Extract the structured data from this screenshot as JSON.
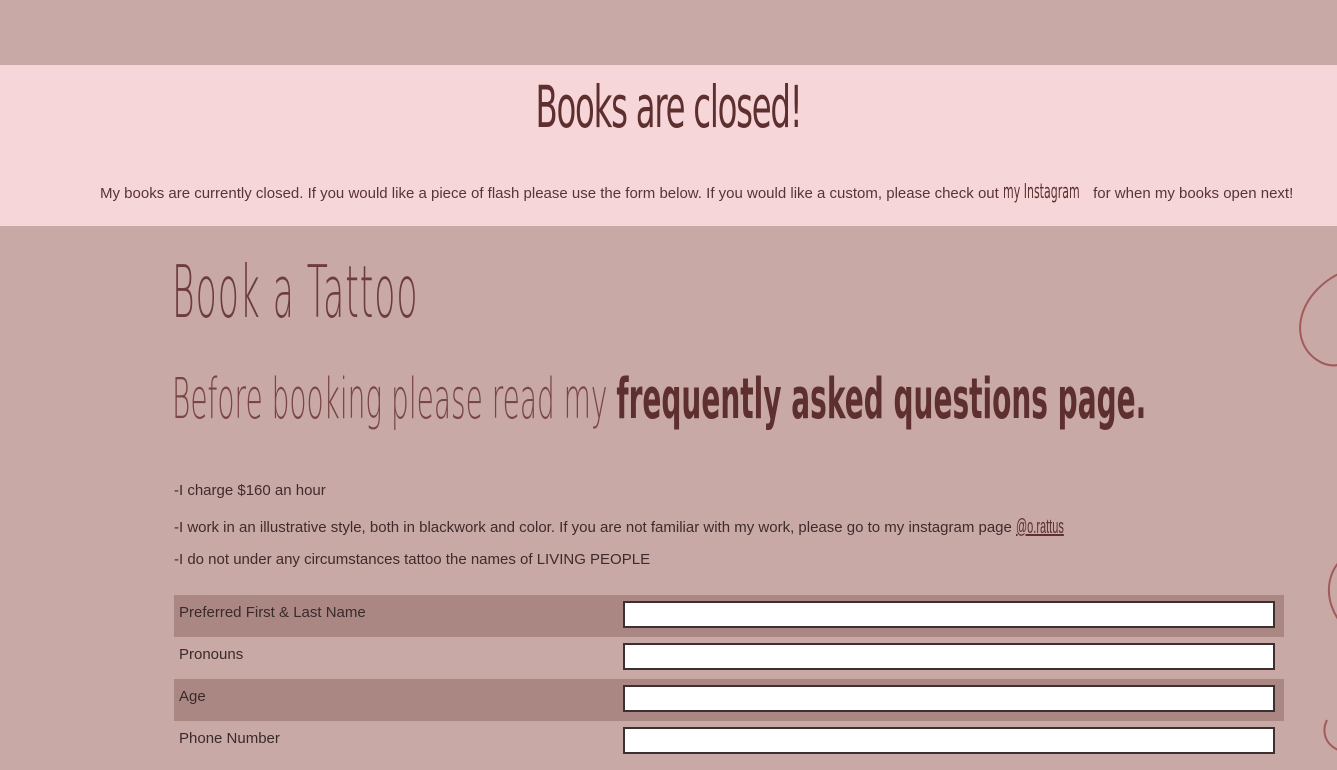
{
  "banner": {
    "title": "Books are closed!",
    "text_before": "My books are currently closed. If you would like a piece of flash please use the form below. If you would like a custom, please check out ",
    "link": "my Instagram",
    "text_after": " for when my books open next!"
  },
  "page": {
    "title": "Book a Tattoo",
    "subtitle_prefix": "Before booking please read my ",
    "subtitle_link": "frequently asked questions page."
  },
  "info": {
    "rate": "-I charge $160 an hour",
    "style_text": "-I work in an illustrative style, both in blackwork and color. If you are not familiar with my work, please go to my instagram page ",
    "instagram_handle": "@o.rattus",
    "names_policy": "-I do not under any circumstances tattoo the names of LIVING PEOPLE"
  },
  "form": {
    "fields": [
      {
        "label": "Preferred First & Last Name",
        "value": ""
      },
      {
        "label": "Pronouns",
        "value": ""
      },
      {
        "label": "Age",
        "value": ""
      },
      {
        "label": "Phone Number",
        "value": ""
      }
    ]
  },
  "colors": {
    "background": "#c8a9a6",
    "banner": "#f7d6da",
    "accent": "#5e2f2f",
    "row_shade": "#ab8784"
  }
}
